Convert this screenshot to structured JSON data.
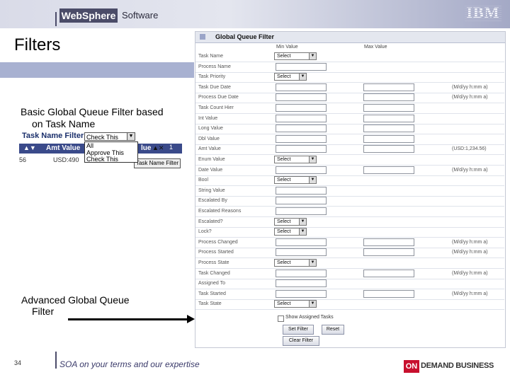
{
  "header": {
    "brand": "WebSphere",
    "product": "Software",
    "company": "IBM"
  },
  "title": "Filters",
  "basic": {
    "caption_line1": "Basic Global Queue Filter based",
    "caption_line2": "on Task Name",
    "task_name_filter_label": "Task Name Filter",
    "selected_value": "Check This",
    "dropdown_options": [
      "All",
      "Approve This",
      "Check This"
    ],
    "amt_value_header": "Amt Value",
    "value_header_fragment": "lue",
    "row_col1": "56",
    "row_col2": "USD:490",
    "page_indicator": "1",
    "button_label": "Task Name Filter"
  },
  "advanced": {
    "caption_line1": "Advanced Global Queue",
    "caption_line2": "Filter"
  },
  "form": {
    "title": "Global Queue Filter",
    "min_header": "Min Value",
    "max_header": "Max Value",
    "rows": [
      {
        "label": "Task Name",
        "kind": "select",
        "value": "Select"
      },
      {
        "label": "Process Name",
        "kind": "input"
      },
      {
        "label": "Task Priority",
        "kind": "select",
        "value": "Select"
      },
      {
        "label": "Task Due Date",
        "kind": "range",
        "hint": "(M/d/yy h:mm a)"
      },
      {
        "label": "Process Due Date",
        "kind": "range",
        "hint": "(M/d/yy h:mm a)"
      },
      {
        "label": "Task Count Hier",
        "kind": "range"
      },
      {
        "label": "Int Value",
        "kind": "range"
      },
      {
        "label": "Long Value",
        "kind": "range"
      },
      {
        "label": "Dbl Value",
        "kind": "range"
      },
      {
        "label": "Amt Value",
        "kind": "range",
        "hint": "(USD:1,234.56)"
      },
      {
        "label": "Enum Value",
        "kind": "select",
        "value": "Select"
      },
      {
        "label": "Date Value",
        "kind": "range",
        "hint": "(M/d/yy h:mm a)"
      },
      {
        "label": "Bool",
        "kind": "select",
        "value": "Select"
      },
      {
        "label": "String Value",
        "kind": "input"
      },
      {
        "label": "Escalated By",
        "kind": "input"
      },
      {
        "label": "Escalated Reasons",
        "kind": "input"
      },
      {
        "label": "Escalated?",
        "kind": "select",
        "value": "Select"
      },
      {
        "label": "Lock?",
        "kind": "select",
        "value": "Select"
      },
      {
        "label": "Process Changed",
        "kind": "range",
        "hint": "(M/d/yy h:mm a)"
      },
      {
        "label": "Process Started",
        "kind": "range",
        "hint": "(M/d/yy h:mm a)"
      },
      {
        "label": "Process State",
        "kind": "select",
        "value": "Select"
      },
      {
        "label": "Task Changed",
        "kind": "range",
        "hint": "(M/d/yy h:mm a)"
      },
      {
        "label": "Assigned To",
        "kind": "input"
      },
      {
        "label": "Task Started",
        "kind": "range",
        "hint": "(M/d/yy h:mm a)"
      },
      {
        "label": "Task State",
        "kind": "select",
        "value": "Select"
      }
    ],
    "show_assigned_label": "Show Assigned Tasks",
    "set_filter_label": "Set Filter",
    "reset_label": "Reset",
    "clear_filter_label": "Clear Filter"
  },
  "footer": {
    "page_number": "34",
    "tagline": "SOA on your terms and our expertise",
    "badge_on": "ON",
    "badge_text": "DEMAND BUSINESS"
  }
}
